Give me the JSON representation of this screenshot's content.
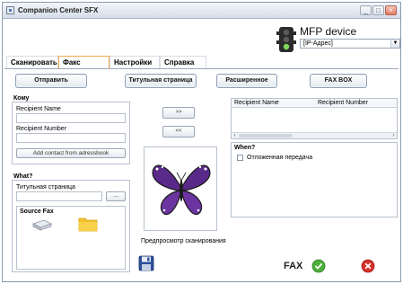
{
  "window": {
    "title": "Companion Center SFX",
    "minimize": "_",
    "maximize": "□",
    "close": "×"
  },
  "device": {
    "title": "MFP device",
    "selected": "[IP-Адрес]",
    "dropdown_arrow": "▼"
  },
  "tabs": [
    {
      "label": "Сканировать"
    },
    {
      "label": "Факс"
    },
    {
      "label": "Настройки"
    },
    {
      "label": "Справка"
    }
  ],
  "actions": {
    "send": "Отправить",
    "cover_page": "Титульная страница",
    "advanced": "Расширенное",
    "fax_box": "FAX BOX"
  },
  "to_group": {
    "label": "Кому",
    "recipient_name_label": "Recipient Name",
    "recipient_number_label": "Recipient Number",
    "add_contact": "Add contact from adressbook"
  },
  "transfer": {
    "add": ">>",
    "remove": "<<"
  },
  "recipients_list": {
    "col_name": "Recipient Name",
    "col_number": "Recipient Number",
    "scroll_left": "‹",
    "scroll_right": "›"
  },
  "what_group": {
    "label": "What?",
    "cover_label": "Титульная страница",
    "browse": "....",
    "source_label": "Source Fax"
  },
  "preview": {
    "caption": "Предпросмотр сканирования"
  },
  "when_group": {
    "label": "When?",
    "delayed": "Отложенная передача"
  },
  "footer": {
    "fax_label": "FAX"
  },
  "colors": {
    "accent_tab": "#f0a94a",
    "ok": "#4caf3a",
    "cancel": "#d7322a"
  },
  "icons": [
    "app-icon",
    "traffic-light-icon",
    "scanner-icon",
    "folder-icon",
    "save-icon",
    "ok-icon",
    "cancel-icon",
    "butterfly-image"
  ]
}
